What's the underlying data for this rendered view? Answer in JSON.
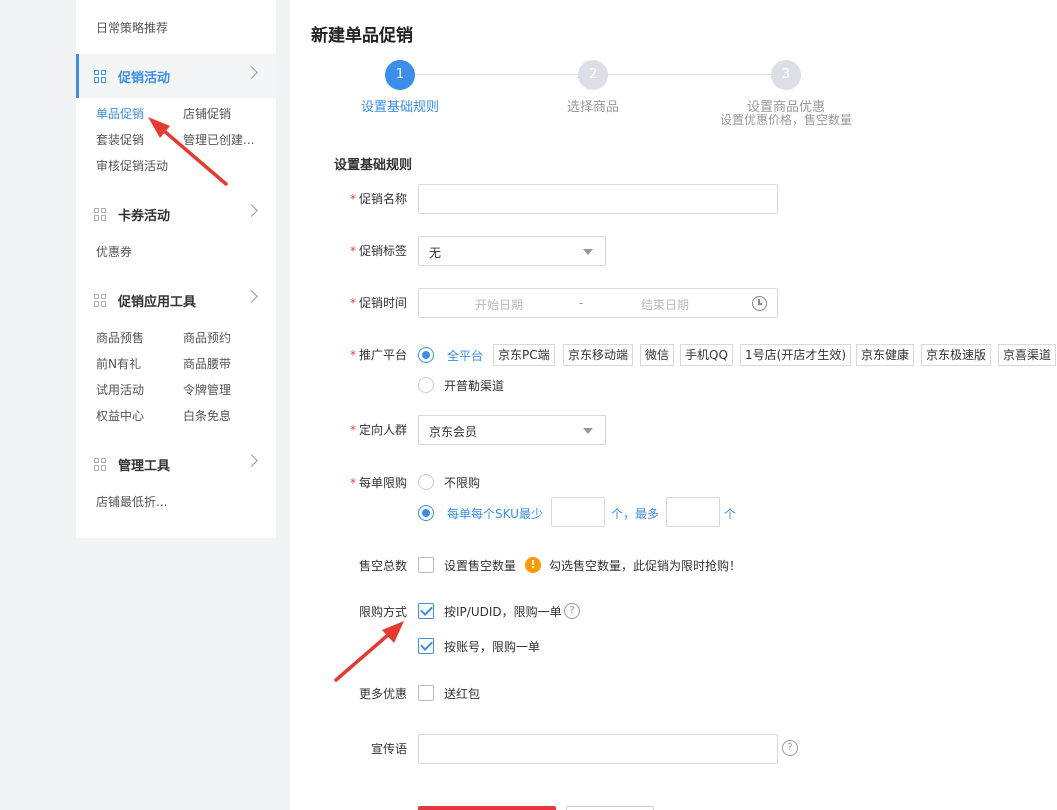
{
  "sidebar": {
    "top_link": "日常策略推荐",
    "sections": [
      {
        "title": "促销活动",
        "links": [
          "单品促销",
          "店铺促销",
          "套装促销",
          "管理已创建...",
          "审核促销活动"
        ]
      },
      {
        "title": "卡券活动",
        "links": [
          "优惠券"
        ]
      },
      {
        "title": "促销应用工具",
        "links": [
          "商品预售",
          "商品预约",
          "前N有礼",
          "商品腰带",
          "试用活动",
          "令牌管理",
          "权益中心",
          "白条免息"
        ]
      },
      {
        "title": "管理工具",
        "links": [
          "店铺最低折..."
        ]
      }
    ]
  },
  "page": {
    "title": "新建单品促销",
    "steps": [
      {
        "num": "1",
        "label": "设置基础规则",
        "sub": ""
      },
      {
        "num": "2",
        "label": "选择商品",
        "sub": ""
      },
      {
        "num": "3",
        "label": "设置商品优惠",
        "sub": "设置优惠价格，售空数量"
      }
    ],
    "section_title": "设置基础规则"
  },
  "form": {
    "name": {
      "label": "促销名称",
      "value": ""
    },
    "tag": {
      "label": "促销标签",
      "value": "无"
    },
    "time": {
      "label": "促销时间",
      "start_placeholder": "开始日期",
      "separator": "-",
      "end_placeholder": "结束日期"
    },
    "platform": {
      "label": "推广平台",
      "all": "全平台",
      "tags": [
        "京东PC端",
        "京东移动端",
        "微信",
        "手机QQ",
        "1号店(开店才生效)",
        "京东健康",
        "京东极速版",
        "京喜渠道"
      ],
      "other": "开普勒渠道"
    },
    "audience": {
      "label": "定向人群",
      "value": "京东会员"
    },
    "limit": {
      "label": "每单限购",
      "opt_none": "不限购",
      "opt_sku": "每单每个SKU最少",
      "unit1": "个，最多",
      "unit2": "个"
    },
    "soldout": {
      "label": "售空总数",
      "check_text": "设置售空数量",
      "warn_text": "勾选售空数量，此促销为限时抢购！"
    },
    "method": {
      "label": "限购方式",
      "opt_ip": "按IP/UDID，限购一单",
      "opt_account": "按账号，限购一单"
    },
    "more": {
      "label": "更多优惠",
      "check_text": "送红包"
    },
    "slogan": {
      "label": "宣传语",
      "value": ""
    }
  },
  "colors": {
    "accent": "#3b8eea",
    "required": "#e64340",
    "warning": "#ff9900",
    "arrow": "#e8392f"
  }
}
